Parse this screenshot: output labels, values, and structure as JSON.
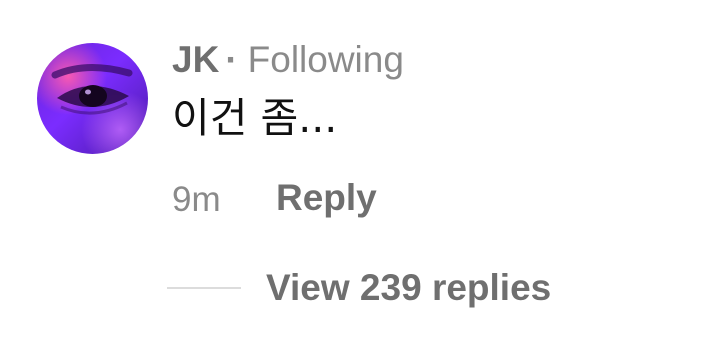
{
  "comment": {
    "username": "JK",
    "separator": "·",
    "follow_status": "Following",
    "text": "이건 좀...",
    "time": "9m",
    "reply_label": "Reply",
    "view_replies_label": "View 239 replies"
  },
  "colors": {
    "avatar_primary": "#7b2cff",
    "avatar_secondary": "#ff3d9a",
    "username": "#6f6f6f",
    "meta": "#8a8a8a",
    "comment_text": "#111111"
  }
}
